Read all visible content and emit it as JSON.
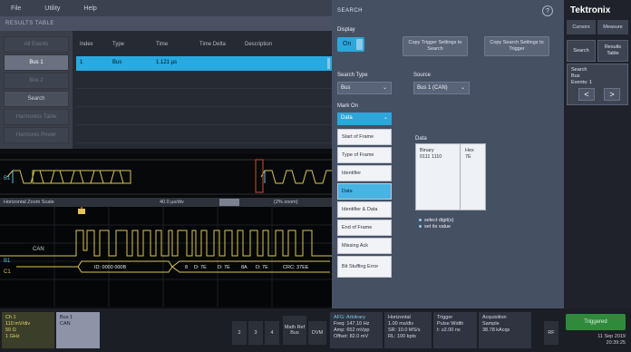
{
  "menu": {
    "items": [
      "File",
      "Utility",
      "Help"
    ]
  },
  "results": {
    "title": "RESULTS TABLE",
    "side_items": [
      "All Events",
      "Bus 1",
      "Bus 2",
      "Search",
      "Harmonics Table",
      "Harmonic Power"
    ],
    "active_side": "Bus 1",
    "columns": [
      "Index",
      "Type",
      "Time",
      "Time Delta",
      "Description"
    ],
    "selected_row": {
      "index": "1",
      "type": "Bus",
      "time": "1.121 µs",
      "time_delta": "",
      "description": ""
    }
  },
  "search": {
    "title": "SEARCH",
    "display_label": "Display",
    "display_value": "On",
    "copy_trigger_label": "Copy Trigger Settings to Search",
    "copy_search_label": "Copy Search Settings to Trigger",
    "search_type_label": "Search Type",
    "search_type_value": "Bus",
    "source_label": "Source",
    "source_value": "Bus 1 (CAN)",
    "mark_on_label": "Mark On",
    "mark_on_value": "Data",
    "mark_options": [
      "Start of Frame",
      "Type of Frame",
      "Identifier",
      "Data",
      "Identifier & Data",
      "End of Frame",
      "Missing Ack",
      "Bit Stuffing Error"
    ],
    "selected_mark": "Data",
    "data_label": "Data",
    "binary_header": "Binary",
    "binary_value": "0111 1110",
    "hex_header": "Hex",
    "hex_value": "7E",
    "hint_1": "select digit(s)",
    "hint_2": "set its value"
  },
  "right_panel": {
    "logo": "Tektronix",
    "tabs": [
      "Cursors",
      "Measure"
    ],
    "buttons": [
      "Search",
      "Results Table"
    ],
    "search_badge": {
      "title": "Search",
      "line1": "Bus",
      "line2": "Events: 1"
    },
    "prev": "<",
    "next": ">"
  },
  "zoom": {
    "label": "Horizontal Zoom Scale",
    "scale": "40.0 µs/div",
    "percent": "(2% zoom)"
  },
  "waveform": {
    "can_label": "CAN",
    "bus_label": "B1",
    "ch_label": "C1",
    "decoded": [
      "ID: 0000 000B",
      "8",
      "D: 7E",
      "D: 7E",
      "8A",
      "D: 7E",
      "CRC: 37EE"
    ]
  },
  "bottom": {
    "ch1": {
      "label": "Ch 1",
      "scale": "110 mV/div",
      "imp": "50 Ω",
      "bw": "1 GHz"
    },
    "bus1": {
      "label": "Bus 1",
      "type": "CAN"
    },
    "channels": [
      "2",
      "3",
      "4"
    ],
    "dvm_label": "DVM",
    "math_label": "Math Ref Bus",
    "afg": {
      "label": "AFG: Arbitrary",
      "freq": "Freq: 147.10 Hz",
      "amp": "Amp: 652 mVpp",
      "offset": "Offset: 82.0 mV"
    },
    "horizontal": {
      "label": "Horizontal",
      "scale": "1.00 ms/div",
      "sr": "SR: 10.0 MS/s",
      "rl": "RL: 100 kpts"
    },
    "trigger": {
      "label": "Trigger",
      "type": "Pulse Width",
      "cond": "t: ≥2.00 ns"
    },
    "acquisition": {
      "label": "Acquisition",
      "mode": "Sample",
      "rate": "38.78 kAcqs"
    },
    "rf": "RF",
    "triggered": "Triggered",
    "date": "11 Sep 2019",
    "time": "20:39:25"
  },
  "colors": {
    "accent": "#2da6da",
    "bus": "#e6d36a",
    "trigger": "#2f8a3c"
  }
}
